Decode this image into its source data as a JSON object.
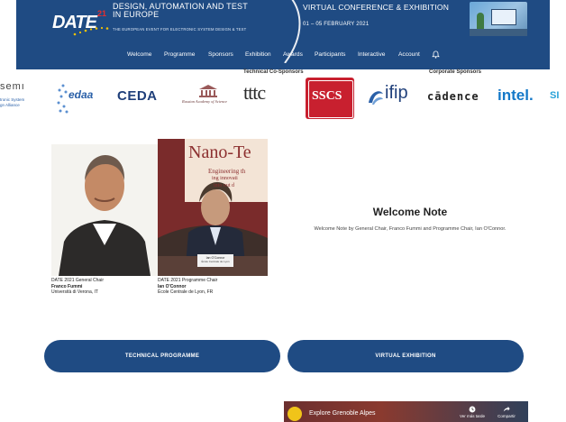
{
  "header": {
    "logo": {
      "text": "DATE",
      "sup": "21"
    },
    "tagline_line1": "DESIGN, AUTOMATION AND TEST",
    "tagline_line2": "IN EUROPE",
    "tagline_sub": "THE EUROPEAN EVENT FOR ELECTRONIC SYSTEM DESIGN & TEST",
    "conference_title": "VIRTUAL CONFERENCE & EXHIBITION",
    "conference_dates": "01 – 05 FEBRUARY 2021",
    "colors": {
      "background": "#1f4b83",
      "accent": "#e52e2e",
      "star": "#f2c200"
    }
  },
  "nav": {
    "items": [
      {
        "label": "Welcome"
      },
      {
        "label": "Programme"
      },
      {
        "label": "Sponsors"
      },
      {
        "label": "Exhibition"
      },
      {
        "label": "Awards"
      },
      {
        "label": "Participants"
      },
      {
        "label": "Interactive"
      },
      {
        "label": "Account"
      }
    ],
    "bell_icon": "bell-icon"
  },
  "sponsors": {
    "technical_heading": "Technical Co-Sponsors",
    "corporate_heading": "Corporate Sponsors",
    "logos": [
      {
        "name": "semi",
        "text": "semı",
        "sub": "tronic System",
        "sub2": "gn Alliance"
      },
      {
        "name": "edaa",
        "text": "edaa"
      },
      {
        "name": "ceda",
        "text": "CEDA"
      },
      {
        "name": "russian-academy",
        "text": "Russian Academy of Science"
      },
      {
        "name": "tttc",
        "text": "tttc"
      },
      {
        "name": "sscs",
        "text": "SSCS"
      },
      {
        "name": "ifip",
        "text": "ifip"
      },
      {
        "name": "cadence",
        "text": "cādence"
      },
      {
        "name": "intel",
        "text": "intel."
      },
      {
        "name": "si",
        "text": "SI"
      }
    ]
  },
  "people": [
    {
      "role": "DATE 2021 General Chair",
      "name": "Franco Fummi",
      "affiliation": "Università di Verona, IT"
    },
    {
      "role": "DATE 2021 Programme Chair",
      "name": "Ian O'Connor",
      "affiliation": "École Centrale de Lyon, FR"
    }
  ],
  "photo2_bg_text": {
    "line1": "Nano-Te",
    "line2": "Engineering th",
    "line3": "ing innovati",
    "line4": "into out d",
    "badge": "Ian O'Connor",
    "badge_sub": "École Centrale de Lyon"
  },
  "welcome": {
    "title": "Welcome Note",
    "text": "Welcome Note by General Chair, Franco Fummi and Programme Chair, Ian O'Connor."
  },
  "buttons": {
    "technical_programme": "TECHNICAL PROGRAMME",
    "virtual_exhibition": "VIRTUAL EXHIBITION"
  },
  "video": {
    "title": "Explore Grenoble Alpes",
    "watch_later": "Ver más tarde",
    "share": "Compartir"
  }
}
